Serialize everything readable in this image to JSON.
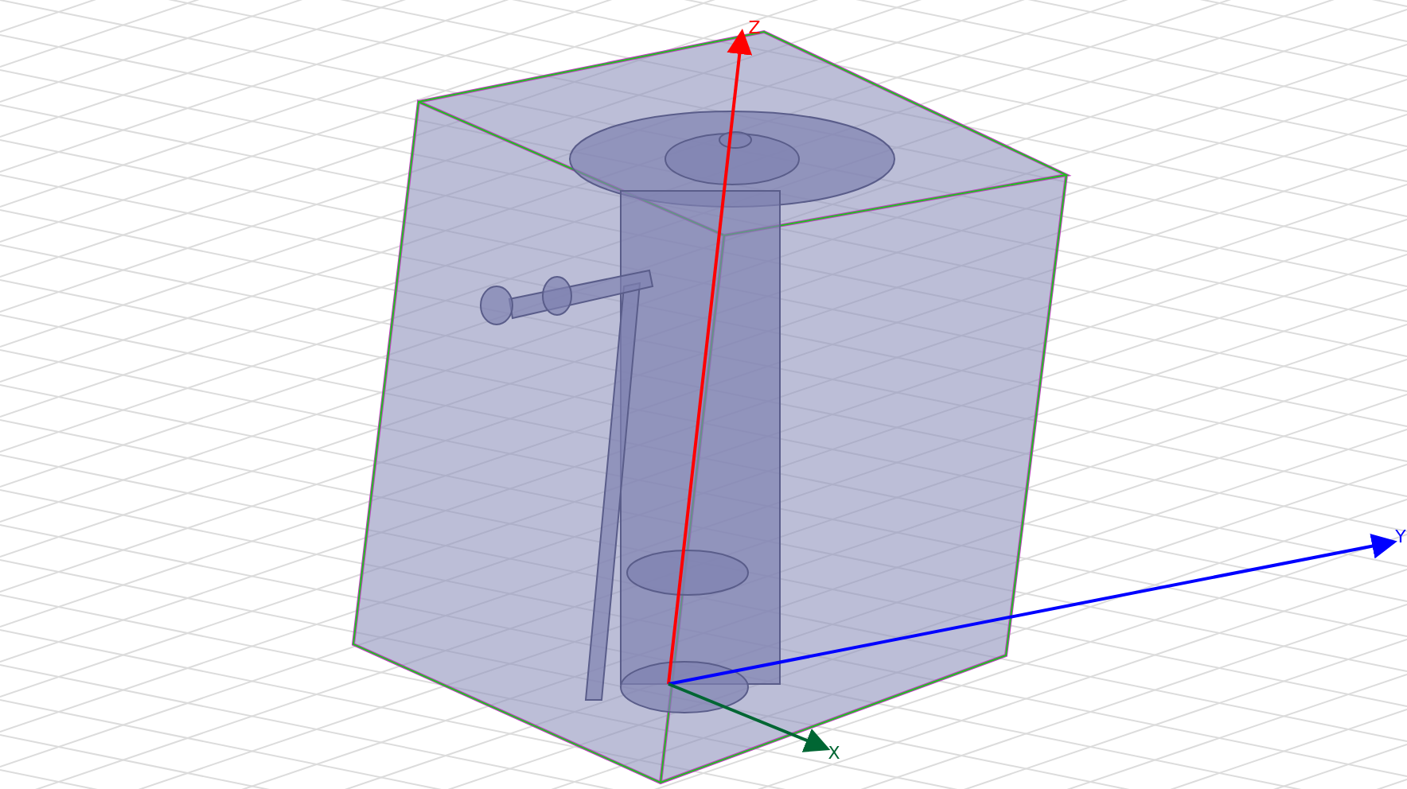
{
  "viewport": {
    "axes": [
      {
        "kind": "z",
        "label": "Z",
        "color": "#ff0000"
      },
      {
        "kind": "y",
        "label": "Y",
        "color": "#0000ff"
      },
      {
        "kind": "x",
        "label": "X",
        "color": "#006633"
      }
    ]
  }
}
